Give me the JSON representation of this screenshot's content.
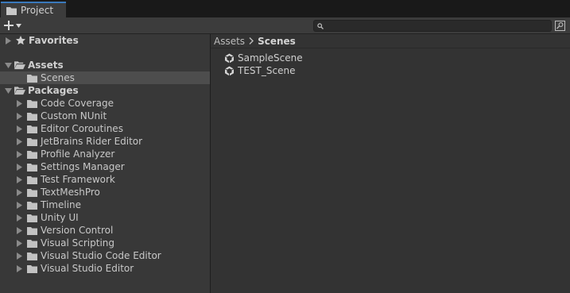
{
  "tab": {
    "label": "Project"
  },
  "search": {
    "value": "",
    "placeholder": ""
  },
  "tree": {
    "favorites": "Favorites",
    "assets": "Assets",
    "scenes": "Scenes",
    "packages": "Packages",
    "package_items": [
      "Code Coverage",
      "Custom NUnit",
      "Editor Coroutines",
      "JetBrains Rider Editor",
      "Profile Analyzer",
      "Settings Manager",
      "Test Framework",
      "TextMeshPro",
      "Timeline",
      "Unity UI",
      "Version Control",
      "Visual Scripting",
      "Visual Studio Code Editor",
      "Visual Studio Editor"
    ]
  },
  "breadcrumb": {
    "root": "Assets",
    "current": "Scenes"
  },
  "assets": [
    {
      "label": "SampleScene"
    },
    {
      "label": "TEST_Scene"
    }
  ],
  "colors": {
    "selection": "#4d4d4d",
    "tab_accent": "#3a79bb",
    "folder": "#c2c2c2"
  }
}
